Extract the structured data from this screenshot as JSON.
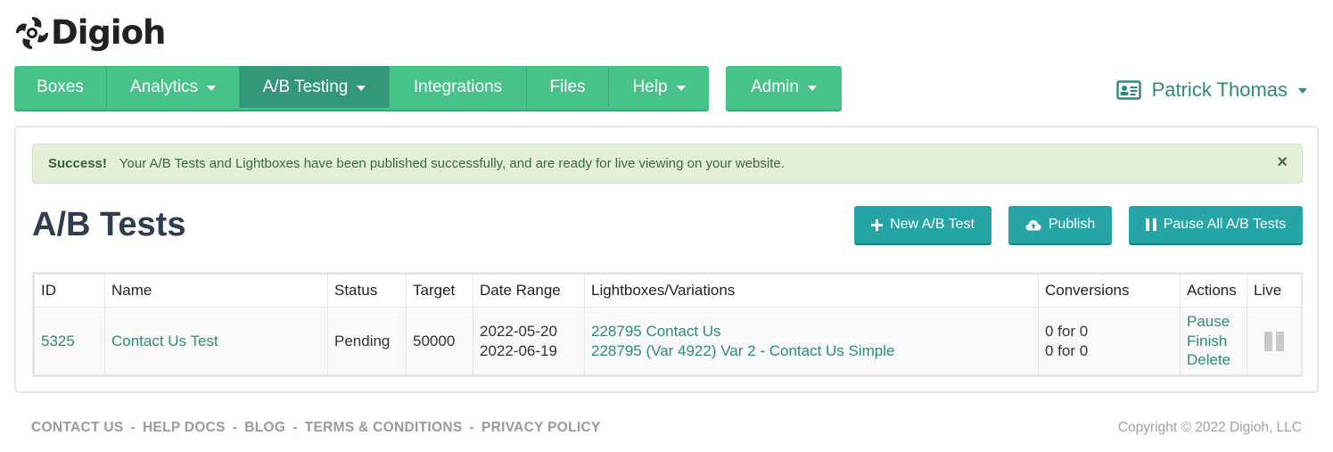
{
  "brand": {
    "name": "Digioh",
    "icon": "digioh-logo-icon"
  },
  "nav": {
    "items": [
      {
        "label": "Boxes",
        "dropdown": false
      },
      {
        "label": "Analytics",
        "dropdown": true
      },
      {
        "label": "A/B Testing",
        "dropdown": true,
        "active": true
      },
      {
        "label": "Integrations",
        "dropdown": false
      },
      {
        "label": "Files",
        "dropdown": false
      },
      {
        "label": "Help",
        "dropdown": true
      }
    ],
    "admin": {
      "label": "Admin",
      "dropdown": true
    }
  },
  "user": {
    "name": "Patrick Thomas",
    "icon": "id-card-icon"
  },
  "alert": {
    "strong": "Success!",
    "message": "Your A/B Tests and Lightboxes have been published successfully, and are ready for live viewing on your website.",
    "close": "×"
  },
  "page": {
    "title": "A/B Tests"
  },
  "buttons": {
    "new_test": "New A/B Test",
    "publish": "Publish",
    "pause_all": "Pause All A/B Tests"
  },
  "table": {
    "headers": [
      "ID",
      "Name",
      "Status",
      "Target",
      "Date Range",
      "Lightboxes/Variations",
      "Conversions",
      "Actions",
      "Live"
    ],
    "rows": [
      {
        "id": "5325",
        "name": "Contact Us Test",
        "status": "Pending",
        "target": "50000",
        "date_start": "2022-05-20",
        "date_end": "2022-06-19",
        "variations": [
          "228795 Contact Us",
          "228795 (Var 4922) Var 2 - Contact Us Simple"
        ],
        "conversions": [
          "0 for 0",
          "0 for 0"
        ],
        "actions": [
          "Pause",
          "Finish",
          "Delete"
        ],
        "live_icon": "pause-icon"
      }
    ]
  },
  "footer": {
    "links": [
      "CONTACT US",
      "HELP DOCS",
      "BLOG",
      "TERMS & CONDITIONS",
      "PRIVACY POLICY"
    ],
    "separator": "-",
    "copyright": "Copyright © 2022 Digioh, LLC"
  },
  "colors": {
    "nav_green": "#47c389",
    "nav_active": "#33987a",
    "button_teal": "#27a4a6",
    "link_green": "#2e8a78",
    "alert_bg": "#e3efd9"
  }
}
